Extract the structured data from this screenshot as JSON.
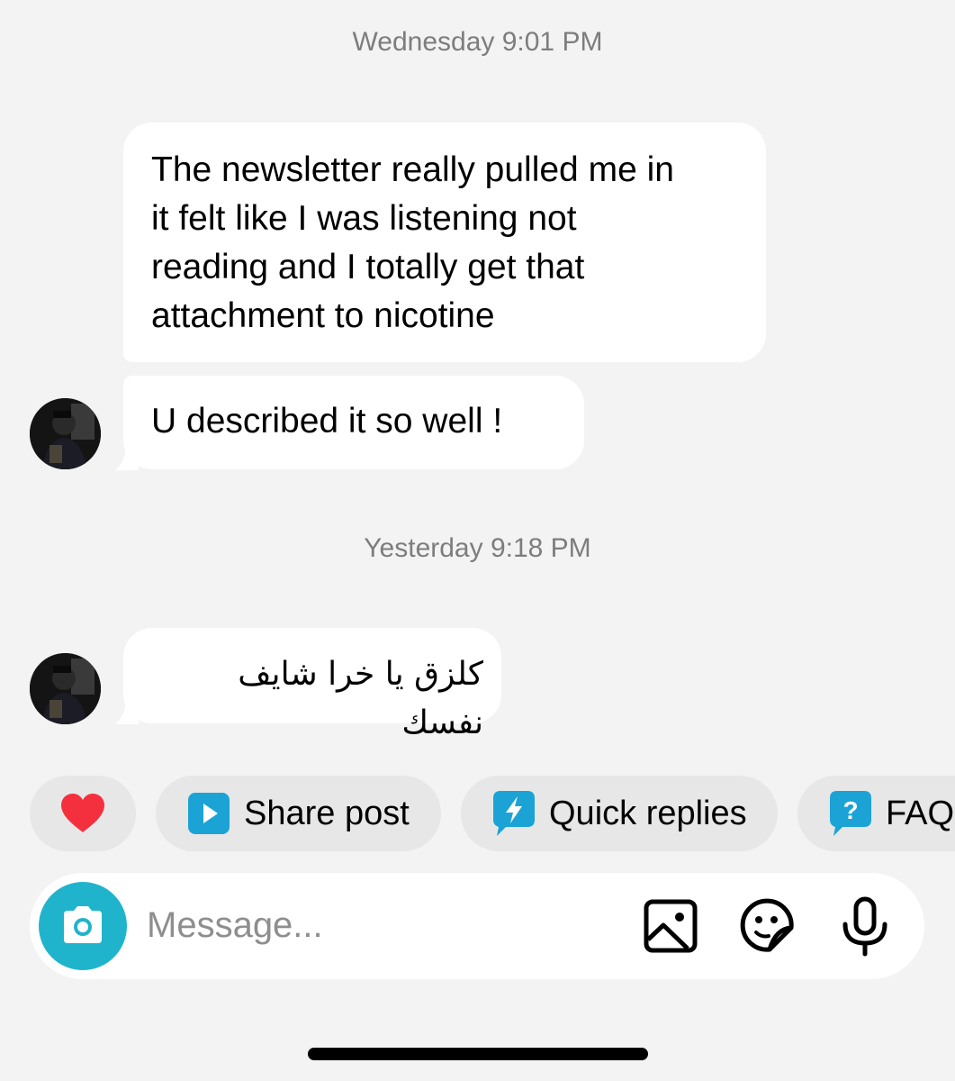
{
  "conversation": {
    "groups": [
      {
        "timestamp": "Wednesday 9:01 PM",
        "messages": [
          {
            "sender": "other",
            "lines": [
              "The newsletter really pulled me in",
              "it felt like I was listening not",
              "reading and I totally get that",
              "attachment to nicotine"
            ]
          },
          {
            "sender": "other",
            "text": "U described it so well !"
          }
        ]
      },
      {
        "timestamp": "Yesterday 9:18 PM",
        "messages": [
          {
            "sender": "other",
            "text": "كلزق يا خرا شايف نفسك"
          }
        ]
      }
    ]
  },
  "quick_actions": {
    "heart": {
      "icon": "heart-icon",
      "color": "#f4303f"
    },
    "share_post": {
      "icon": "play-square-icon",
      "label": "Share post",
      "color": "#1ba3d6"
    },
    "quick_replies": {
      "icon": "lightning-bubble-icon",
      "label": "Quick replies",
      "color": "#1ba3d6"
    },
    "faqs": {
      "icon": "question-bubble-icon",
      "label": "FAQs",
      "color": "#1ba3d6"
    }
  },
  "composer": {
    "placeholder": "Message...",
    "camera": {
      "icon": "camera-icon",
      "color": "#20b4cc"
    },
    "gallery": {
      "icon": "gallery-icon"
    },
    "sticker": {
      "icon": "sticker-icon"
    },
    "mic": {
      "icon": "microphone-icon"
    }
  }
}
